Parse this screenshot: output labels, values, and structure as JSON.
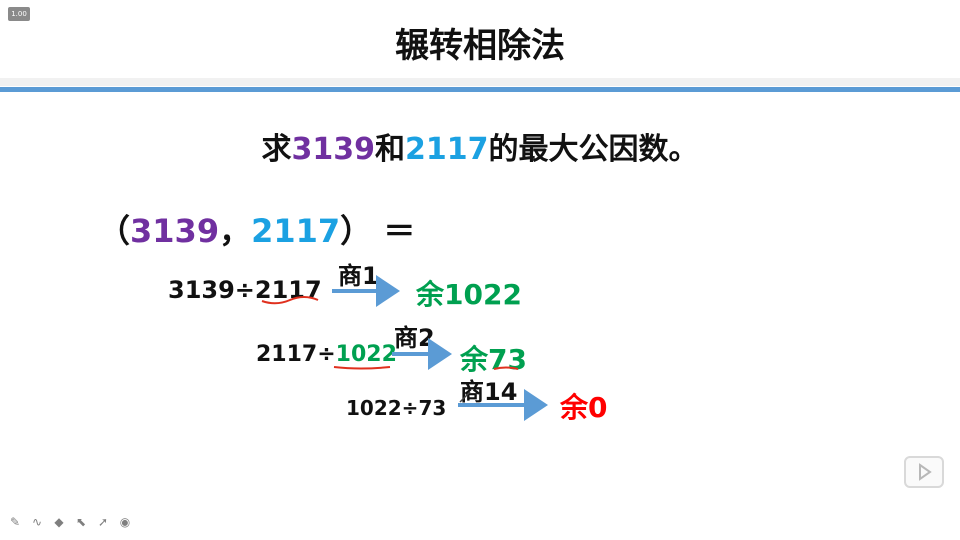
{
  "zoom_badge": "1.00",
  "slide": {
    "title": "辗转相除法",
    "question": {
      "prefix": "求",
      "a": "3139",
      "middle": "和",
      "b": "2117",
      "suffix": "的最大公因数。"
    },
    "gcd_expr": {
      "open": "（",
      "a": "3139",
      "sep": "，",
      "b": "2117",
      "close": "）",
      "equals": "＝"
    },
    "steps": [
      {
        "dividend": "3139",
        "op": "÷",
        "divisor": "2117",
        "quotient": "商1",
        "remainder": "余1022"
      },
      {
        "dividend": "2117",
        "op": "÷",
        "divisor": "1022",
        "quotient": "商2",
        "remainder": "余73"
      },
      {
        "dividend": "1022",
        "op": "÷",
        "divisor": "73",
        "quotient": "商14",
        "remainder": "余0"
      }
    ]
  },
  "colors": {
    "accent_rule": "#5b9bd5",
    "purple": "#7030a0",
    "blue": "#1ba1e2",
    "green": "#00a050",
    "red": "#ff0000",
    "arrow": "#5b9bd5"
  },
  "toolbar": {
    "tools": [
      "pen-icon",
      "curve-icon",
      "eraser-icon",
      "pointer-icon",
      "arrow-cursor-icon",
      "record-icon"
    ],
    "play_button": "play-icon"
  }
}
